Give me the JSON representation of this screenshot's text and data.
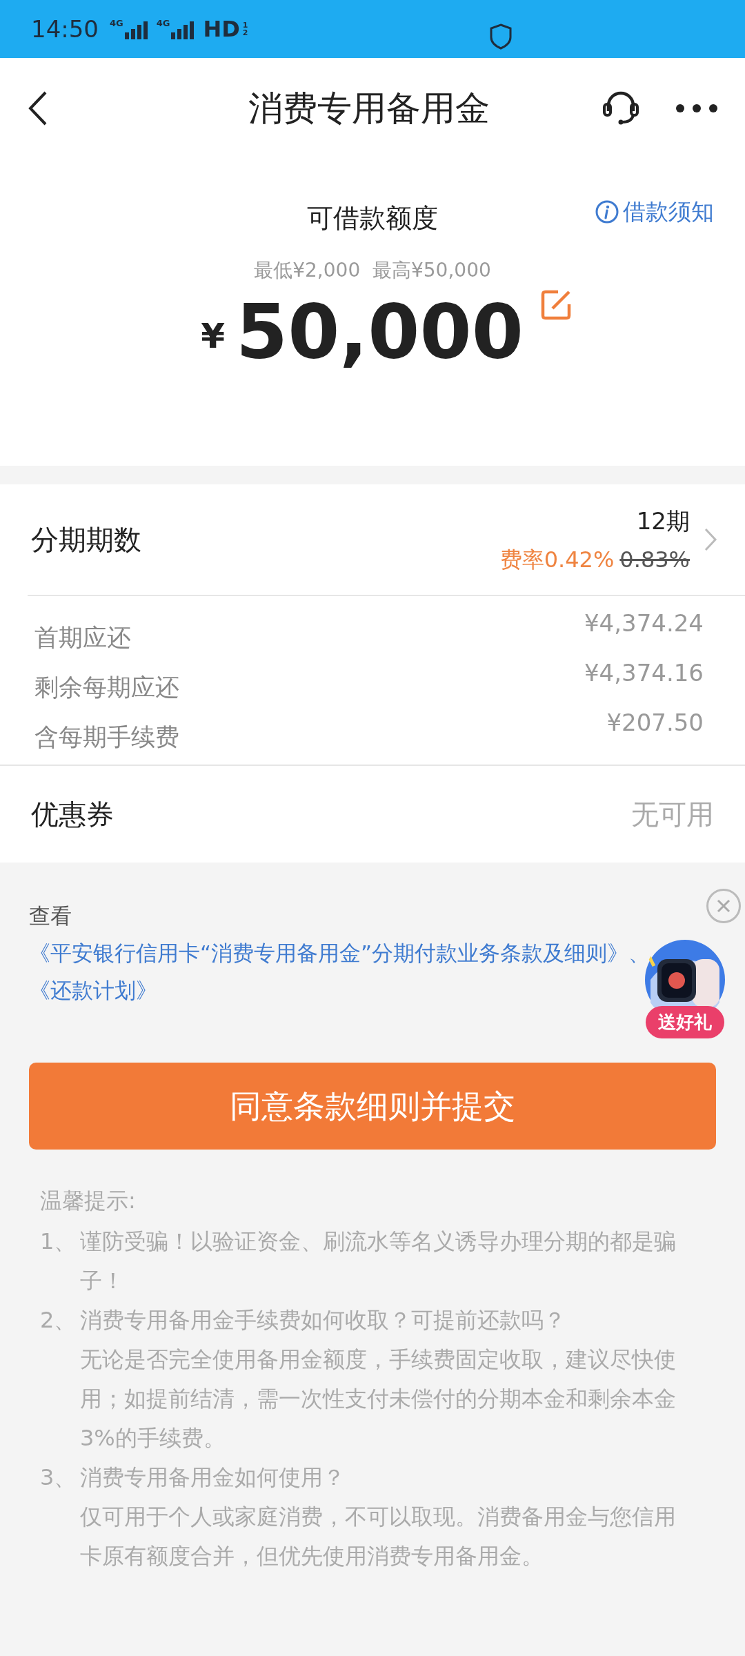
{
  "status_bar": {
    "time": "14:50",
    "networks": [
      "4G",
      "4G"
    ],
    "hd": "HD",
    "sims": [
      "1",
      "2"
    ]
  },
  "header": {
    "title": "消费专用备用金"
  },
  "limit": {
    "label": "可借款额度",
    "notice_link": "借款须知",
    "range": "最低¥2,000  最高¥50,000",
    "currency": "¥",
    "amount": "50,000"
  },
  "installment": {
    "label": "分期期数",
    "value": "12期",
    "rate": "费率0.42%",
    "original_rate": "0.83%"
  },
  "details": [
    {
      "label": "首期应还",
      "value": "¥4,374.24"
    },
    {
      "label": "剩余每期应还",
      "value": "¥4,374.16"
    },
    {
      "label": "含每期手续费",
      "value": "¥207.50"
    }
  ],
  "coupon": {
    "label": "优惠券",
    "value": "无可用"
  },
  "agreement": {
    "prefix": "查看",
    "links": [
      "《平安银行信用卡“消费专用备用金”分期付款业务条款及细则》",
      "《还款计划》"
    ],
    "separator": "、"
  },
  "gift_badge": {
    "label": "送好礼"
  },
  "submit_button": "同意条款细则并提交",
  "tips": {
    "title": "温馨提示:",
    "items": [
      {
        "number": "1、",
        "paragraphs": [
          "谨防受骗！以验证资金、刷流水等名义诱导办理分期的都是骗子！"
        ]
      },
      {
        "number": "2、",
        "paragraphs": [
          "消费专用备用金手续费如何收取？可提前还款吗？",
          "无论是否完全使用备用金额度，手续费固定收取，建议尽快使用；如提前结清，需一次性支付未偿付的分期本金和剩余本金3%的手续费。"
        ]
      },
      {
        "number": "3、",
        "paragraphs": [
          "消费专用备用金如何使用？",
          "仅可用于个人或家庭消费，不可以取现。消费备用金与您信用卡原有额度合并，但优先使用消费专用备用金。"
        ]
      }
    ]
  }
}
